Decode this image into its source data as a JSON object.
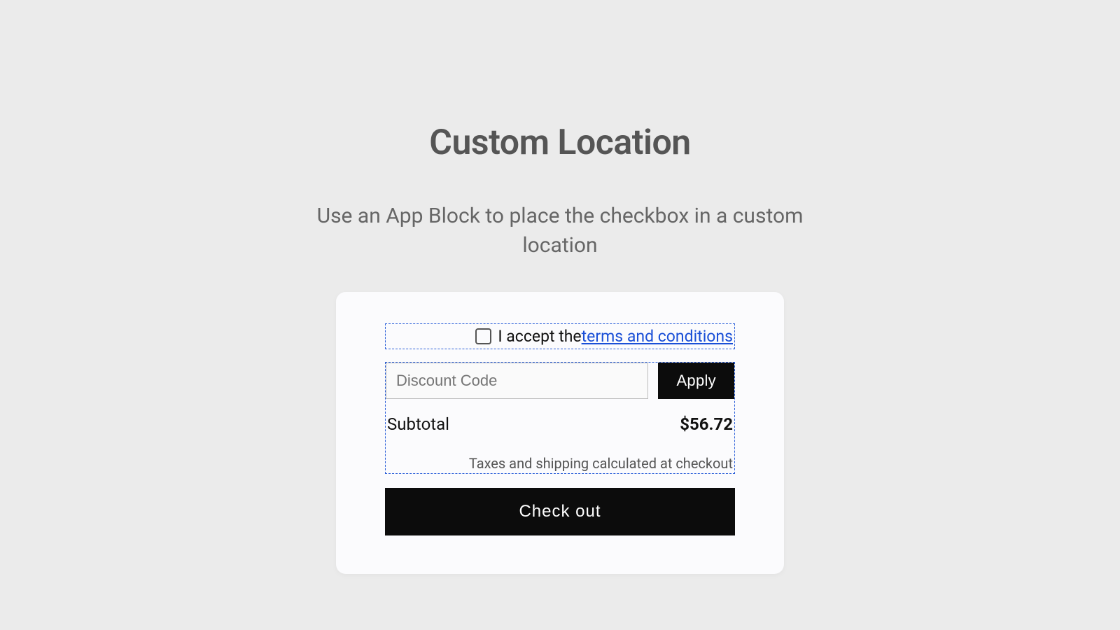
{
  "header": {
    "title": "Custom Location",
    "subtitle": "Use an App Block to place the checkbox in a custom location"
  },
  "card": {
    "terms": {
      "prefix": "I accept the ",
      "link_label": "terms and conditions"
    },
    "discount": {
      "placeholder": "Discount Code",
      "apply_label": "Apply"
    },
    "subtotal": {
      "label": "Subtotal",
      "value": "$56.72"
    },
    "tax_note": "Taxes and shipping calculated at checkout",
    "checkout_label": "Check out"
  }
}
